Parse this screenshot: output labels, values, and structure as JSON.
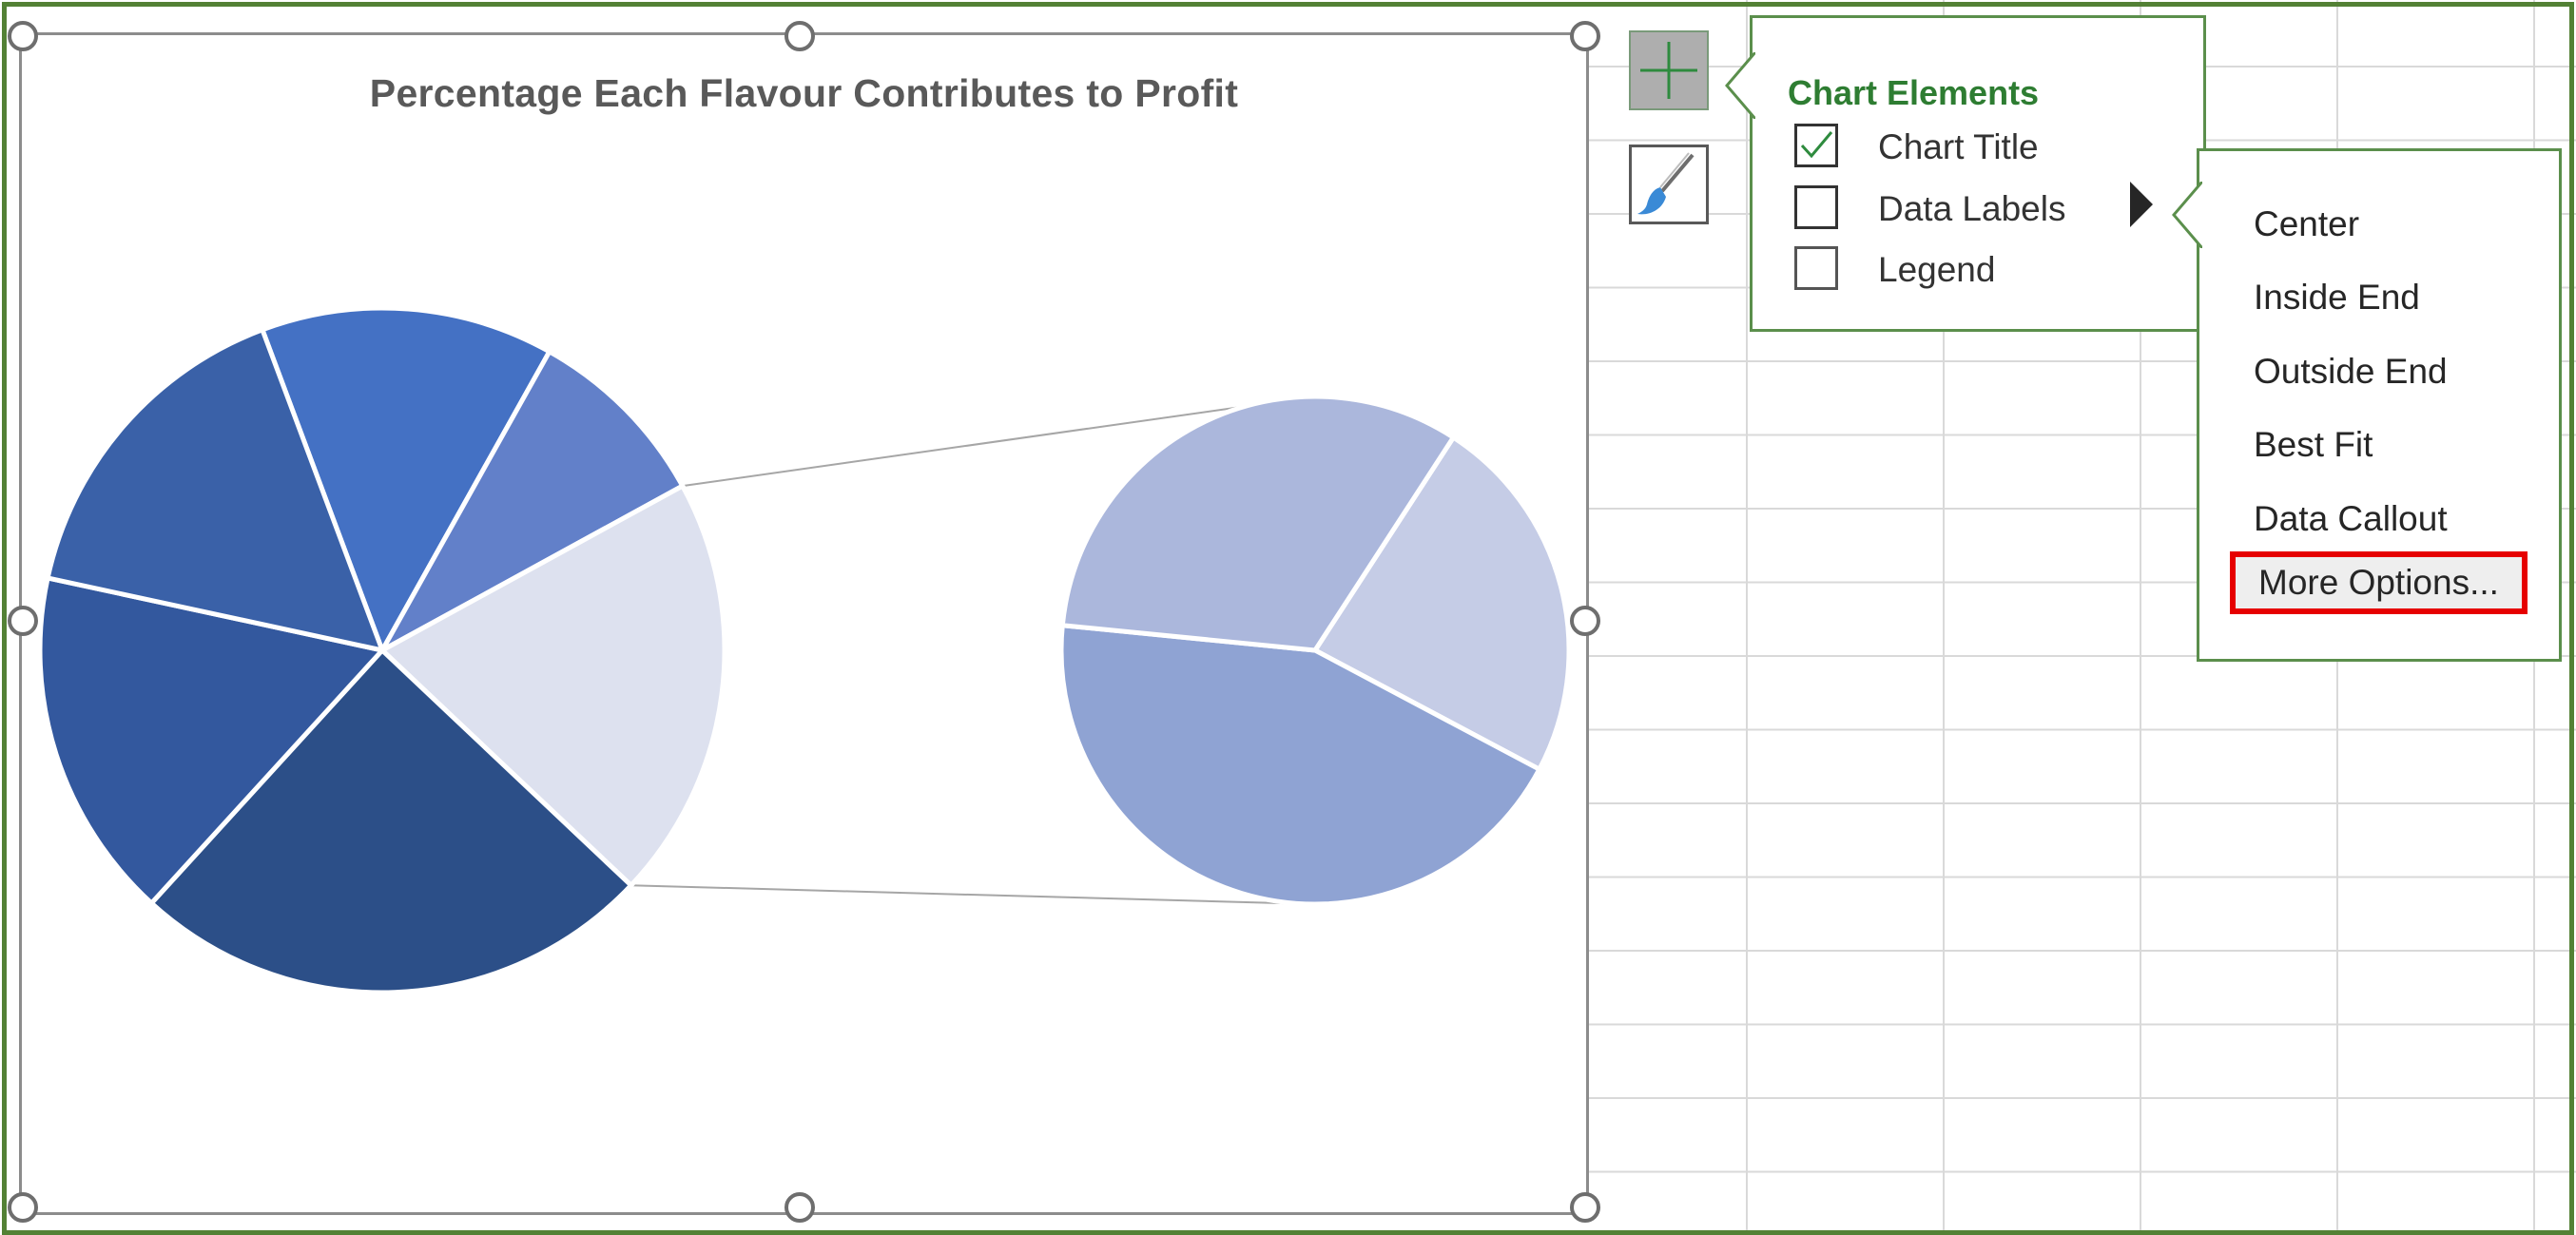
{
  "chart": {
    "title": "Percentage Each Flavour Contributes to Profit",
    "colors": {
      "main": [
        "#4471c4",
        "#6280c9",
        "#dde1ef",
        "#2c4f88",
        "#33589e",
        "#3a61a8"
      ],
      "secondary": [
        "#c5cce6",
        "#8fa3d3",
        "#abb7dc"
      ]
    }
  },
  "chart_data": {
    "type": "pie",
    "subtype": "pie-of-pie",
    "title": "Percentage Each Flavour Contributes to Profit",
    "primary_slices": [
      13.8,
      8.9,
      20.0,
      24.7,
      16.6,
      15.9
    ],
    "secondary_slices": [
      23.6,
      43.8,
      32.6
    ],
    "legend": "none",
    "data_labels": "none"
  },
  "toolbar": {
    "add_element_icon": "plus-icon",
    "chart_styles_icon": "paintbrush-icon"
  },
  "chart_elements": {
    "title": "Chart Elements",
    "items": [
      {
        "label": "Chart Title",
        "checked": true
      },
      {
        "label": "Data Labels",
        "checked": false
      },
      {
        "label": "Legend",
        "checked": false
      }
    ]
  },
  "data_labels_menu": {
    "options": [
      "Center",
      "Inside End",
      "Outside End",
      "Best Fit",
      "Data Callout",
      "More Options..."
    ],
    "highlighted": "More Options..."
  }
}
